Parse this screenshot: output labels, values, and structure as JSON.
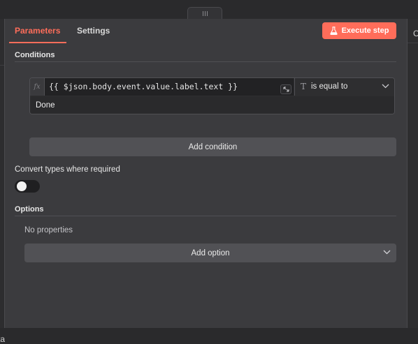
{
  "tabs": {
    "parameters": "Parameters",
    "settings": "Settings"
  },
  "execute_button": "Execute step",
  "conditions": {
    "title": "Conditions",
    "fx_label": "fx",
    "left_value": "{{ $json.body.event.value.label.text }}",
    "operator_type_glyph": "T",
    "operator": "is equal to",
    "right_value": "Done",
    "add_condition": "Add condition"
  },
  "convert_types": {
    "label": "Convert types where required",
    "enabled": false
  },
  "options": {
    "title": "Options",
    "empty_text": "No properties",
    "add_option": "Add option"
  },
  "background": {
    "left_fragment": "ta",
    "right_fragment": "C"
  },
  "colors": {
    "accent": "#ff6d5a",
    "panel_bg": "#3b3b3e",
    "page_bg": "#2a2a2c"
  }
}
